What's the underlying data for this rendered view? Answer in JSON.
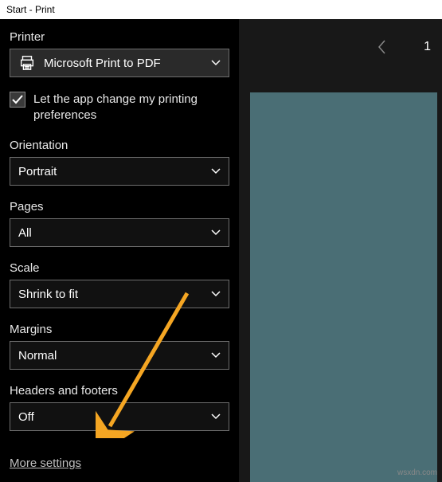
{
  "titlebar": "Start - Print",
  "leftPanel": {
    "printer": {
      "label": "Printer",
      "value": "Microsoft Print to PDF"
    },
    "checkbox": {
      "checked": true,
      "label": "Let the app change my printing preferences"
    },
    "orientation": {
      "label": "Orientation",
      "value": "Portrait"
    },
    "pages": {
      "label": "Pages",
      "value": "All"
    },
    "scale": {
      "label": "Scale",
      "value": "Shrink to fit"
    },
    "margins": {
      "label": "Margins",
      "value": "Normal"
    },
    "headersFooters": {
      "label": "Headers and footers",
      "value": "Off"
    },
    "moreSettings": "More settings"
  },
  "rightPanel": {
    "pageNumber": "1"
  },
  "watermark": "wsxdn.com"
}
